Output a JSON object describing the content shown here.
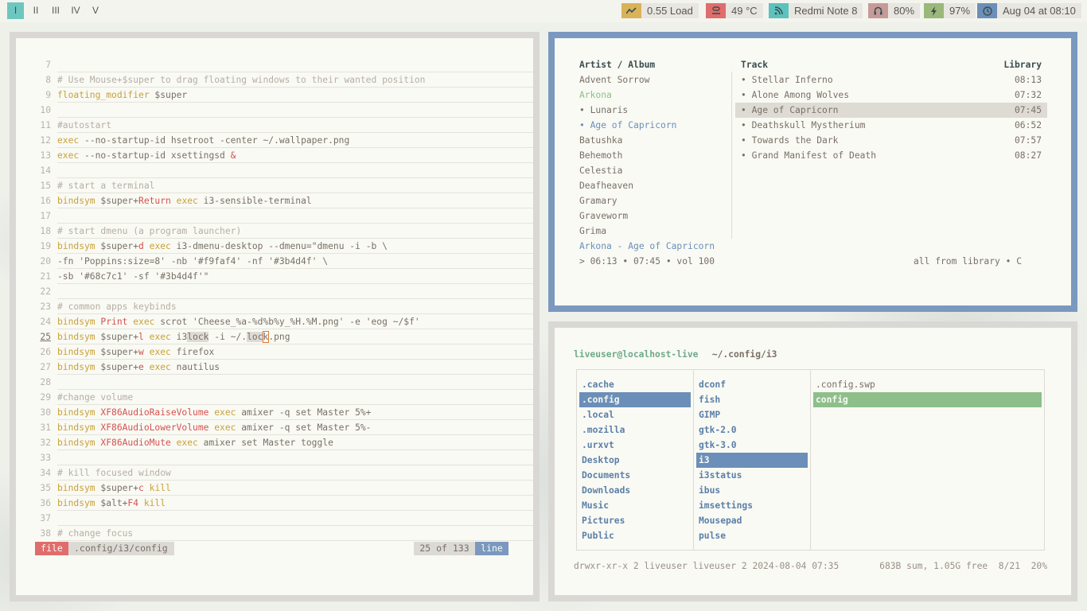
{
  "workspaces": [
    "I",
    "II",
    "III",
    "IV",
    "V"
  ],
  "status": {
    "load": {
      "icon": "load-graph-icon",
      "text": "0.55 Load",
      "color": "#d9b35a"
    },
    "temp": {
      "icon": "thermometer-icon",
      "text": "49 °C",
      "color": "#e06c6c"
    },
    "network": {
      "icon": "wifi-icon",
      "text": "Redmi Note 8",
      "color": "#5cc2be"
    },
    "volume": {
      "icon": "headphones-icon",
      "text": "80%",
      "color": "#c79a9a"
    },
    "battery": {
      "icon": "battery-bolt-icon",
      "text": "97%",
      "color": "#9ab87a"
    },
    "clock": {
      "icon": "clock-icon",
      "text": "Aug 04 at 08:10",
      "color": "#6b8fb8"
    }
  },
  "editor": {
    "lines": [
      {
        "n": "7",
        "parts": []
      },
      {
        "n": "8",
        "parts": [
          [
            "c-com",
            "# Use Mouse+$super to drag floating windows to their wanted position"
          ]
        ]
      },
      {
        "n": "9",
        "parts": [
          [
            "c-kw",
            "floating_modifier"
          ],
          [
            "c-txt",
            " $super"
          ]
        ]
      },
      {
        "n": "10",
        "parts": []
      },
      {
        "n": "11",
        "parts": [
          [
            "c-com",
            "#autostart"
          ]
        ]
      },
      {
        "n": "12",
        "parts": [
          [
            "c-kw",
            "exec"
          ],
          [
            "c-txt",
            " --no-startup-id hsetroot -center ~/.wallpaper.png"
          ]
        ]
      },
      {
        "n": "13",
        "parts": [
          [
            "c-kw",
            "exec"
          ],
          [
            "c-txt",
            " --no-startup-id xsettingsd "
          ],
          [
            "c-key",
            "&"
          ]
        ]
      },
      {
        "n": "14",
        "parts": []
      },
      {
        "n": "15",
        "parts": [
          [
            "c-com",
            "# start a terminal"
          ]
        ]
      },
      {
        "n": "16",
        "parts": [
          [
            "c-kw",
            "bindsym"
          ],
          [
            "c-txt",
            " $super+"
          ],
          [
            "c-key",
            "Return"
          ],
          [
            "c-kw",
            " exec"
          ],
          [
            "c-txt",
            " i3-sensible-terminal"
          ]
        ]
      },
      {
        "n": "17",
        "parts": []
      },
      {
        "n": "18",
        "parts": [
          [
            "c-com",
            "# start dmenu (a program launcher)"
          ]
        ]
      },
      {
        "n": "19",
        "parts": [
          [
            "c-kw",
            "bindsym"
          ],
          [
            "c-txt",
            " $super+"
          ],
          [
            "c-key",
            "d"
          ],
          [
            "c-kw",
            " exec"
          ],
          [
            "c-txt",
            " i3-dmenu-desktop --dmenu=\"dmenu -i -b \\"
          ]
        ]
      },
      {
        "n": "20",
        "parts": [
          [
            "c-txt",
            "-fn 'Poppins:size=8' -nb '#f9faf4' -nf '#3b4d4f' \\"
          ]
        ]
      },
      {
        "n": "21",
        "parts": [
          [
            "c-txt",
            "-sb '#68c7c1' -sf '#3b4d4f'\""
          ]
        ]
      },
      {
        "n": "22",
        "parts": []
      },
      {
        "n": "23",
        "parts": [
          [
            "c-com",
            "# common apps keybinds"
          ]
        ]
      },
      {
        "n": "24",
        "parts": [
          [
            "c-kw",
            "bindsym"
          ],
          [
            "c-key",
            " Print"
          ],
          [
            "c-kw",
            " exec"
          ],
          [
            "c-txt",
            " scrot 'Cheese_%a-%d%b%y_%H.%M.png' -e 'eog ~/$f'"
          ]
        ]
      },
      {
        "n": "25",
        "parts": [
          [
            "c-kw",
            "bindsym"
          ],
          [
            "c-txt",
            " $super+"
          ],
          [
            "c-key",
            "l"
          ],
          [
            "c-kw",
            " exec"
          ],
          [
            "c-txt",
            " i3"
          ],
          [
            "hl",
            "lock"
          ],
          [
            "c-txt",
            " -i ~/."
          ],
          [
            "hl",
            "loc"
          ],
          [
            "cur",
            "k"
          ],
          [
            "c-txt",
            ".png"
          ]
        ]
      },
      {
        "n": "26",
        "parts": [
          [
            "c-kw",
            "bindsym"
          ],
          [
            "c-txt",
            " $super+"
          ],
          [
            "c-key",
            "w"
          ],
          [
            "c-kw",
            " exec"
          ],
          [
            "c-txt",
            " firefox"
          ]
        ]
      },
      {
        "n": "27",
        "parts": [
          [
            "c-kw",
            "bindsym"
          ],
          [
            "c-txt",
            " $super+"
          ],
          [
            "c-key",
            "e"
          ],
          [
            "c-kw",
            " exec"
          ],
          [
            "c-txt",
            " nautilus"
          ]
        ]
      },
      {
        "n": "28",
        "parts": []
      },
      {
        "n": "29",
        "parts": [
          [
            "c-com",
            "#change volume"
          ]
        ]
      },
      {
        "n": "30",
        "parts": [
          [
            "c-kw",
            "bindsym"
          ],
          [
            "c-key",
            " XF86AudioRaiseVolume"
          ],
          [
            "c-kw",
            " exec"
          ],
          [
            "c-txt",
            " amixer -q set Master 5%+"
          ]
        ]
      },
      {
        "n": "31",
        "parts": [
          [
            "c-kw",
            "bindsym"
          ],
          [
            "c-key",
            " XF86AudioLowerVolume"
          ],
          [
            "c-kw",
            " exec"
          ],
          [
            "c-txt",
            " amixer -q set Master 5%-"
          ]
        ]
      },
      {
        "n": "32",
        "parts": [
          [
            "c-kw",
            "bindsym"
          ],
          [
            "c-key",
            " XF86AudioMute"
          ],
          [
            "c-kw",
            " exec"
          ],
          [
            "c-txt",
            " amixer set Master toggle"
          ]
        ]
      },
      {
        "n": "33",
        "parts": []
      },
      {
        "n": "34",
        "parts": [
          [
            "c-com",
            "# kill focused window"
          ]
        ]
      },
      {
        "n": "35",
        "parts": [
          [
            "c-kw",
            "bindsym"
          ],
          [
            "c-txt",
            " $super+"
          ],
          [
            "c-key",
            "c"
          ],
          [
            "c-kw",
            " kill"
          ]
        ]
      },
      {
        "n": "36",
        "parts": [
          [
            "c-kw",
            "bindsym"
          ],
          [
            "c-txt",
            " $alt+"
          ],
          [
            "c-key",
            "F4"
          ],
          [
            "c-kw",
            " kill"
          ]
        ]
      },
      {
        "n": "37",
        "parts": []
      },
      {
        "n": "38",
        "parts": [
          [
            "c-com",
            "# change focus"
          ]
        ]
      }
    ],
    "current_line": "25",
    "statusline": {
      "mode": "file",
      "path": ".config/i3/config",
      "position": "25 of 133",
      "kind": "line"
    }
  },
  "music": {
    "headers": {
      "artist": "Artist / Album",
      "track": "Track",
      "library": "Library"
    },
    "artists": [
      {
        "text": "Advent Sorrow",
        "style": "normal"
      },
      {
        "text": "Arkona",
        "style": "green"
      },
      {
        "text": "• Lunaris",
        "style": "normal"
      },
      {
        "text": "• Age of Capricorn",
        "style": "blue"
      },
      {
        "text": "Batushka",
        "style": "normal"
      },
      {
        "text": "Behemoth",
        "style": "normal"
      },
      {
        "text": "Celestia",
        "style": "normal"
      },
      {
        "text": "Deafheaven",
        "style": "normal"
      },
      {
        "text": "Gramary",
        "style": "normal"
      },
      {
        "text": "Graveworm",
        "style": "normal"
      },
      {
        "text": "Grima",
        "style": "normal"
      }
    ],
    "tracks": [
      {
        "title": "• Stellar Inferno",
        "time": "08:13",
        "selected": false
      },
      {
        "title": "• Alone Among Wolves",
        "time": "07:32",
        "selected": false
      },
      {
        "title": "• Age of Capricorn",
        "time": "07:45",
        "selected": true
      },
      {
        "title": "• Deathskull Mystherium",
        "time": "06:52",
        "selected": false
      },
      {
        "title": "• Towards the Dark",
        "time": "07:57",
        "selected": false
      },
      {
        "title": "• Grand Manifest of Death",
        "time": "08:27",
        "selected": false
      }
    ],
    "now_playing": "Arkona - Age of Capricorn",
    "progress": "> 06:13 • 07:45 • vol 100",
    "mode": "all from library • C"
  },
  "files": {
    "prompt_user": "liveuser@localhost-live",
    "prompt_path": " ~/.config/i3",
    "col1": [
      ".cache",
      ".config",
      ".local",
      ".mozilla",
      ".urxvt",
      "Desktop",
      "Documents",
      "Downloads",
      "Music",
      "Pictures",
      "Public"
    ],
    "col1_selected": 1,
    "col2": [
      "dconf",
      "fish",
      "GIMP",
      "gtk-2.0",
      "gtk-3.0",
      "i3",
      "i3status",
      "ibus",
      "imsettings",
      "Mousepad",
      "pulse"
    ],
    "col2_selected": 5,
    "col3": [
      ".config.swp",
      "config"
    ],
    "col3_selected": 1,
    "footer_left": "drwxr-xr-x 2 liveuser liveuser 2 2024-08-04 07:35",
    "footer_right": "683B sum, 1.05G free  8/21  20%"
  },
  "colors": {
    "blue": "#6b8fb8",
    "green": "#8dbf8a",
    "red": "#e06c6c",
    "cyan": "#6ec6c0"
  }
}
